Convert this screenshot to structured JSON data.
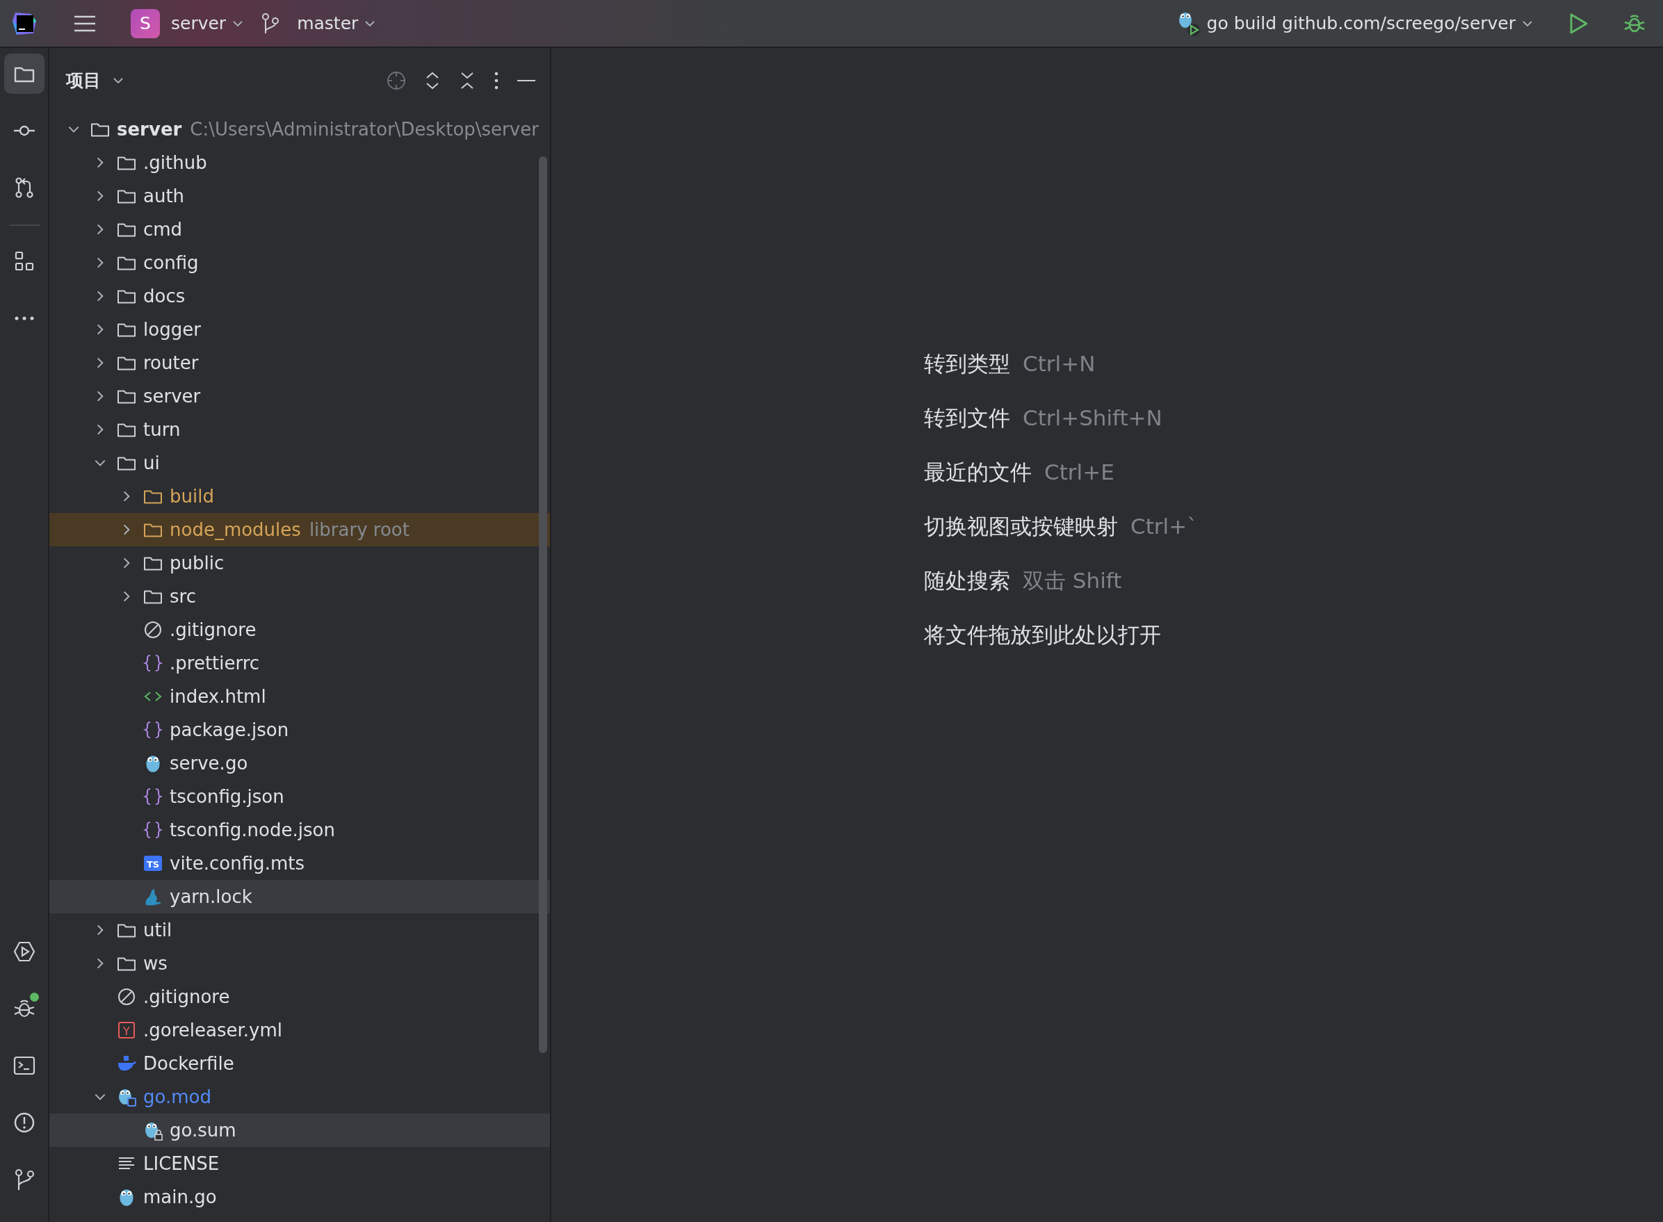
{
  "title_bar": {
    "project_badge": "S",
    "project": "server",
    "branch": "master",
    "run_config": "go build github.com/screego/server"
  },
  "tool_strip": {
    "top": [
      {
        "kind": "project",
        "selected": true
      },
      {
        "kind": "commit",
        "selected": false
      },
      {
        "kind": "pull-requests",
        "selected": false
      },
      {
        "kind": "structure",
        "selected": false
      },
      {
        "kind": "more",
        "selected": false
      }
    ],
    "bottom": [
      {
        "kind": "run",
        "selected": false
      },
      {
        "kind": "debug",
        "selected": false,
        "notification": true
      },
      {
        "kind": "terminal",
        "selected": false
      },
      {
        "kind": "problems",
        "selected": false
      },
      {
        "kind": "git",
        "selected": false
      }
    ]
  },
  "project_panel": {
    "title": "项目",
    "tree": [
      {
        "label": "server",
        "bold": true,
        "hint": "C:\\Users\\Administrator\\Desktop\\server",
        "kind": "folder",
        "expanded": true,
        "selected": false,
        "children": [
          {
            "label": ".github",
            "kind": "folder",
            "expanded": false,
            "selected": false
          },
          {
            "label": "auth",
            "kind": "folder",
            "expanded": false,
            "selected": false
          },
          {
            "label": "cmd",
            "kind": "folder",
            "expanded": false,
            "selected": false
          },
          {
            "label": "config",
            "kind": "folder",
            "expanded": false,
            "selected": false
          },
          {
            "label": "docs",
            "kind": "folder",
            "expanded": false,
            "selected": false
          },
          {
            "label": "logger",
            "kind": "folder",
            "expanded": false,
            "selected": false
          },
          {
            "label": "router",
            "kind": "folder",
            "expanded": false,
            "selected": false
          },
          {
            "label": "server",
            "kind": "folder",
            "expanded": false,
            "selected": false
          },
          {
            "label": "turn",
            "kind": "folder",
            "expanded": false,
            "selected": false
          },
          {
            "label": "ui",
            "kind": "folder",
            "expanded": true,
            "selected": false,
            "children": [
              {
                "label": "build",
                "kind": "excluded",
                "expanded": false,
                "selected": false
              },
              {
                "label": "node_modules",
                "hint": "library root",
                "kind": "library",
                "expanded": false,
                "selected": false
              },
              {
                "label": "public",
                "kind": "folder",
                "expanded": false,
                "selected": false
              },
              {
                "label": "src",
                "kind": "folder",
                "expanded": false,
                "selected": false
              },
              {
                "label": ".gitignore",
                "kind": "ignore",
                "selected": false
              },
              {
                "label": ".prettierrc",
                "kind": "braces",
                "selected": false
              },
              {
                "label": "index.html",
                "kind": "html",
                "selected": false
              },
              {
                "label": "package.json",
                "kind": "braces",
                "selected": false
              },
              {
                "label": "serve.go",
                "kind": "gopher",
                "selected": false
              },
              {
                "label": "tsconfig.json",
                "kind": "braces",
                "selected": false
              },
              {
                "label": "tsconfig.node.json",
                "kind": "braces",
                "selected": false
              },
              {
                "label": "vite.config.mts",
                "kind": "ts",
                "badge": "TS",
                "selected": false
              },
              {
                "label": "yarn.lock",
                "kind": "yarn",
                "selected": true
              }
            ]
          },
          {
            "label": "util",
            "kind": "folder",
            "expanded": false,
            "selected": false
          },
          {
            "label": "ws",
            "kind": "folder",
            "expanded": false,
            "selected": false
          },
          {
            "label": ".gitignore",
            "kind": "ignore",
            "selected": false
          },
          {
            "label": ".goreleaser.yml",
            "kind": "yaml",
            "badge": "Y",
            "selected": false
          },
          {
            "label": "Dockerfile",
            "kind": "docker",
            "selected": false
          },
          {
            "label": "go.mod",
            "kind": "gomod",
            "expanded": true,
            "selected": false,
            "children": [
              {
                "label": "go.sum",
                "kind": "gosum",
                "selected": true
              }
            ]
          },
          {
            "label": "LICENSE",
            "kind": "text",
            "selected": false
          },
          {
            "label": "main.go",
            "kind": "gopher",
            "selected": false
          }
        ]
      }
    ]
  },
  "editor_hints": [
    {
      "action": "转到类型",
      "shortcut": "Ctrl+N"
    },
    {
      "action": "转到文件",
      "shortcut": "Ctrl+Shift+N"
    },
    {
      "action": "最近的文件",
      "shortcut": "Ctrl+E"
    },
    {
      "action": "切换视图或按键映射",
      "shortcut": "Ctrl+`"
    },
    {
      "action": "随处搜索",
      "shortcut": "双击 Shift"
    },
    {
      "action": "将文件拖放到此处以打开"
    }
  ]
}
